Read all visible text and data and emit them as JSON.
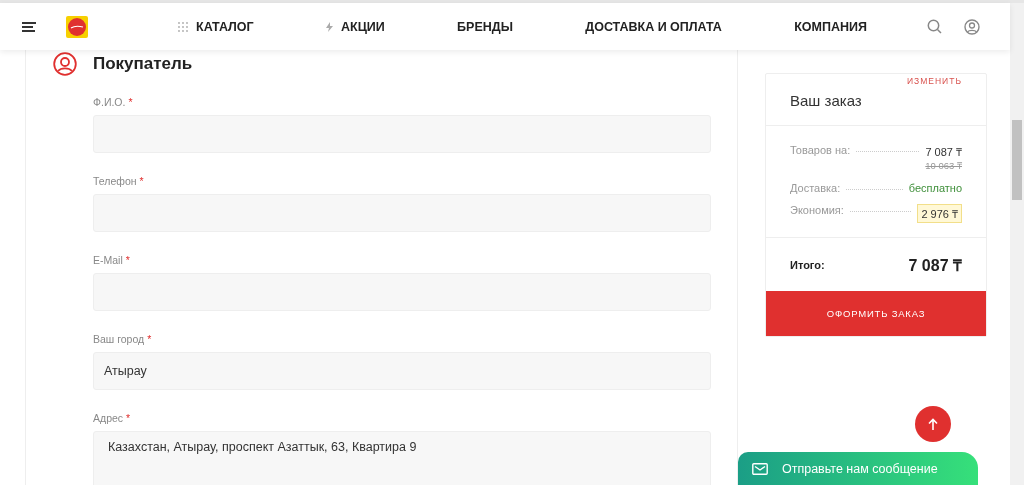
{
  "header": {
    "nav": [
      {
        "kind": "catalog",
        "label": "КАТАЛОГ"
      },
      {
        "kind": "promo",
        "label": "АКЦИИ"
      },
      {
        "kind": "plain",
        "label": "БРЕНДЫ"
      },
      {
        "kind": "plain",
        "label": "ДОСТАВКА И ОПЛАТА"
      },
      {
        "kind": "plain",
        "label": "КОМПАНИЯ"
      }
    ]
  },
  "section": {
    "title": "Покупатель"
  },
  "fields": [
    {
      "kind": "input",
      "label": "Ф.И.О.",
      "required_mark": "*"
    },
    {
      "kind": "input",
      "label": "Телефон",
      "required_mark": "*"
    },
    {
      "kind": "input",
      "label": "E-Mail",
      "required_mark": "*"
    },
    {
      "kind": "input",
      "label": "Ваш город",
      "required_mark": "*",
      "value": "Атырау"
    },
    {
      "kind": "textarea",
      "label": "Адрес",
      "required_mark": "*",
      "value": "Казахстан, Атырау, проспект Азаттык, 63, Квартира 9"
    }
  ],
  "order": {
    "edit_link": "ИЗМЕНИТЬ",
    "title": "Ваш заказ",
    "rows": [
      {
        "kind": "price",
        "label": "Товаров на:",
        "value": "7 087 ₸",
        "old_value": "10 063 ₸"
      },
      {
        "kind": "free",
        "label": "Доставка:",
        "value": "бесплатно"
      },
      {
        "kind": "savings",
        "label": "Экономия:",
        "value": "2 976 ₸"
      }
    ],
    "total_label": "Итого:",
    "total_value": "7 087 ₸",
    "submit": "ОФОРМИТЬ ЗАКАЗ"
  },
  "chat_button": {
    "label": "Отправьте нам сообщение"
  }
}
